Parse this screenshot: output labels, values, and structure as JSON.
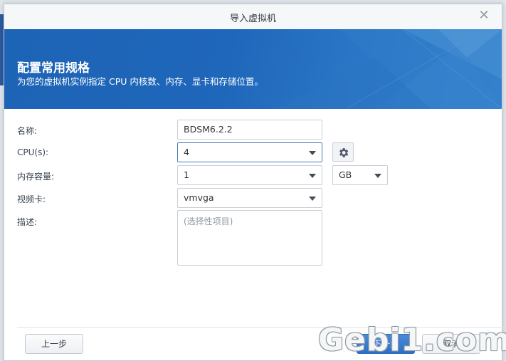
{
  "dialog": {
    "title": "导入虚拟机",
    "close_icon": "close-icon"
  },
  "banner": {
    "heading": "配置常用规格",
    "subtitle": "为您的虚拟机实例指定 CPU 内核数、内存、显卡和存储位置。"
  },
  "form": {
    "name_label": "名称:",
    "name_value": "BDSM6.2.2",
    "cpu_label": "CPU(s):",
    "cpu_value": "4",
    "cpu_settings_icon": "gear-icon",
    "memory_label": "内存容量:",
    "memory_value": "1",
    "memory_unit": "GB",
    "video_label": "视频卡:",
    "video_value": "vmvga",
    "desc_label": "描述:",
    "desc_placeholder": "(选择性项目)"
  },
  "footer": {
    "back_label": "上一步",
    "next_label": "下一步",
    "cancel_label": "取消"
  },
  "watermark": "Gebi1.com",
  "colors": {
    "banner": "#1f67ba",
    "primary_button": "#2e6fc4"
  }
}
